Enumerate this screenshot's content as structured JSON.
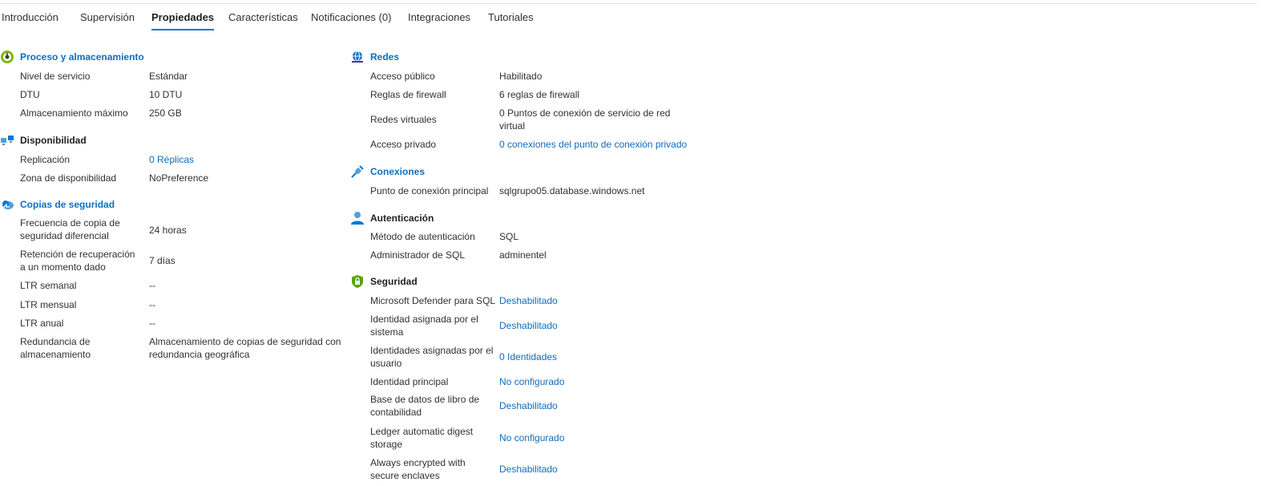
{
  "tabs": [
    "Introducción",
    "Supervisión",
    "Propiedades",
    "Características",
    "Notificaciones (0)",
    "Integraciones",
    "Tutoriales"
  ],
  "active_tab": "Propiedades",
  "left": {
    "compute": {
      "title": "Proceso y almacenamiento",
      "rows": [
        {
          "label": "Nivel de servicio",
          "value": "Estándar"
        },
        {
          "label": "DTU",
          "value": "10 DTU"
        },
        {
          "label": "Almacenamiento máximo",
          "value": "250 GB"
        }
      ]
    },
    "availability": {
      "title": "Disponibilidad",
      "rows": [
        {
          "label": "Replicación",
          "value": "0 Réplicas"
        },
        {
          "label": "Zona de disponibilidad",
          "value": "NoPreference"
        }
      ]
    },
    "backups": {
      "title": "Copias de seguridad",
      "rows": [
        {
          "label": "Frecuencia de copia de seguridad diferencial",
          "value": "24 horas"
        },
        {
          "label": "Retención de recuperación a un momento dado",
          "value": "7 días"
        },
        {
          "label": "LTR semanal",
          "value": "--"
        },
        {
          "label": "LTR mensual",
          "value": "--"
        },
        {
          "label": "LTR anual",
          "value": "--"
        },
        {
          "label": "Redundancia de almacenamiento",
          "value": "Almacenamiento de copias de seguridad con redundancia geográfica"
        }
      ]
    }
  },
  "right": {
    "networks": {
      "title": "Redes",
      "rows": [
        {
          "label": "Acceso público",
          "value": "Habilitado"
        },
        {
          "label": "Reglas de firewall",
          "value": "6 reglas de firewall"
        },
        {
          "label": "Redes virtuales",
          "value": "0 Puntos de conexión de servicio de red virtual"
        },
        {
          "label": "Acceso privado",
          "value": "0 conexiones del punto de conexión privado"
        }
      ]
    },
    "connections": {
      "title": "Conexiones",
      "rows": [
        {
          "label": "Punto de conexión principal",
          "value": "sqlgrupo05.database.windows.net"
        }
      ]
    },
    "auth": {
      "title": "Autenticación",
      "rows": [
        {
          "label": "Método de autenticación",
          "value": "SQL"
        },
        {
          "label": "Administrador de SQL",
          "value": "adminentel"
        }
      ]
    },
    "security": {
      "title": "Seguridad",
      "rows": [
        {
          "label": "Microsoft Defender para SQL",
          "value": "Deshabilitado"
        },
        {
          "label": "Identidad asignada por el sistema",
          "value": "Deshabilitado"
        },
        {
          "label": "Identidades asignadas por el usuario",
          "value": "0 Identidades"
        },
        {
          "label": "Identidad principal",
          "value": "No configurado"
        },
        {
          "label": "Base de datos de libro de contabilidad",
          "value": "Deshabilitado"
        },
        {
          "label": "Ledger automatic digest storage",
          "value": "No configurado"
        },
        {
          "label": "Always encrypted with secure enclaves",
          "value": "Deshabilitado"
        }
      ]
    }
  },
  "icons": {
    "compute": "gauge-icon",
    "availability": "replication-icon",
    "backups": "cloud-backup-icon",
    "networks": "network-globe-icon",
    "connections": "plug-icon",
    "auth": "user-icon",
    "security": "shield-lock-icon"
  },
  "colors": {
    "accent": "#0078d4",
    "link": "#0f6cbd",
    "text": "#323130"
  }
}
